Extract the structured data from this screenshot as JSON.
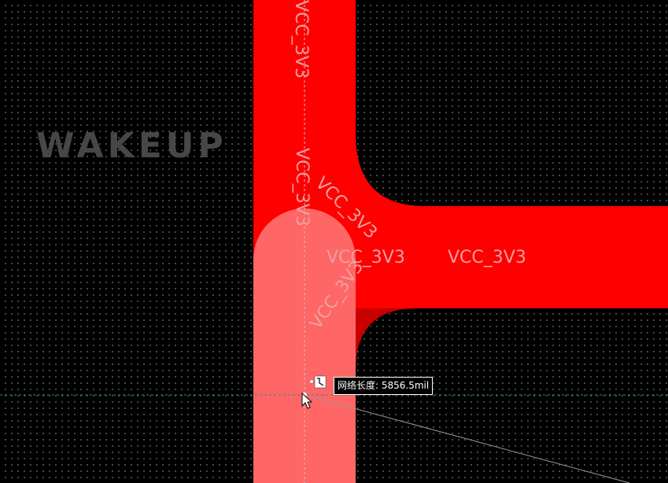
{
  "silkscreen": {
    "text": "WAKEUP"
  },
  "net": {
    "name": "VCC_3V3",
    "labels": [
      "VCC_3V3",
      "VCC_3V3",
      "VCC_3V3",
      "VCC_3V3",
      "VCC_3V3",
      "VCC_3V3"
    ]
  },
  "tooltip": {
    "text": "网络长度: 5856.5mil"
  },
  "colors": {
    "trace_top": "#ff0000",
    "trace_highlight": "#ff6666",
    "trace_shadow": "#c80000",
    "silkscreen": "#474747",
    "grid_dot": "#5a5a5a",
    "crosshair_vertical": "#c8c8c8",
    "crosshair_horizontal": "#2a8a9a",
    "net_label": "#f0a0a0"
  },
  "icons": {
    "net_length": "net-length-icon",
    "cursor": "arrow-cursor-icon"
  }
}
